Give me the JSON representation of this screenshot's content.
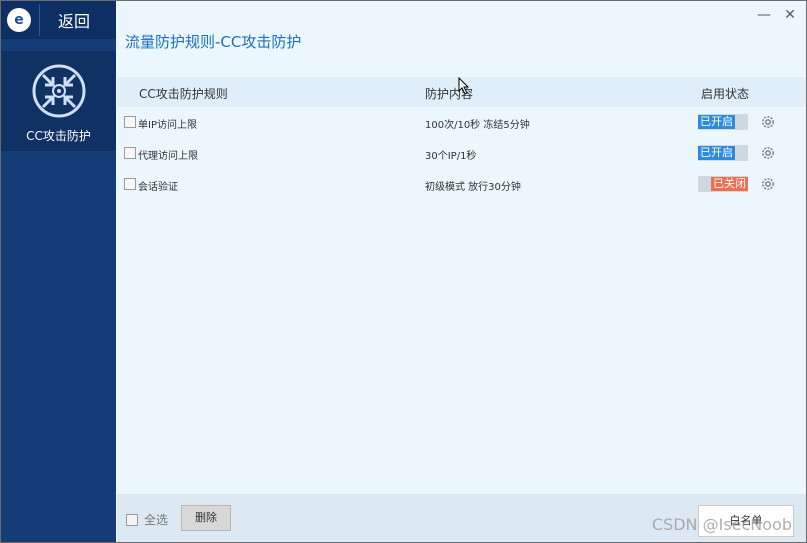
{
  "app": {
    "logo_letter": "e",
    "back_label": "返回"
  },
  "sidebar": {
    "module_label": "CC攻击防护"
  },
  "window_controls": {
    "minimize": "—",
    "close": "✕"
  },
  "page_title": "流量防护规则-CC攻击防护",
  "table": {
    "headers": {
      "rule": "CC攻击防护规则",
      "content": "防护内容",
      "status": "启用状态"
    },
    "rows": [
      {
        "name": "单IP访问上限",
        "content": "100次/10秒  冻结5分钟",
        "status": "已开启",
        "state": "on"
      },
      {
        "name": "代理访问上限",
        "content": "30个IP/1秒",
        "status": "已开启",
        "state": "on"
      },
      {
        "name": "会话验证",
        "content": "初级模式 放行30分钟",
        "status": "已关闭",
        "state": "off"
      }
    ]
  },
  "footer": {
    "select_all": "全选",
    "delete": "删除",
    "whitelist": "白名单"
  },
  "watermark": "CSDN @IsecNoob",
  "colors": {
    "accent": "#1c6fc1",
    "on": "#2e8bd8",
    "off": "#ee6e50",
    "sidebar": "#143d78"
  }
}
